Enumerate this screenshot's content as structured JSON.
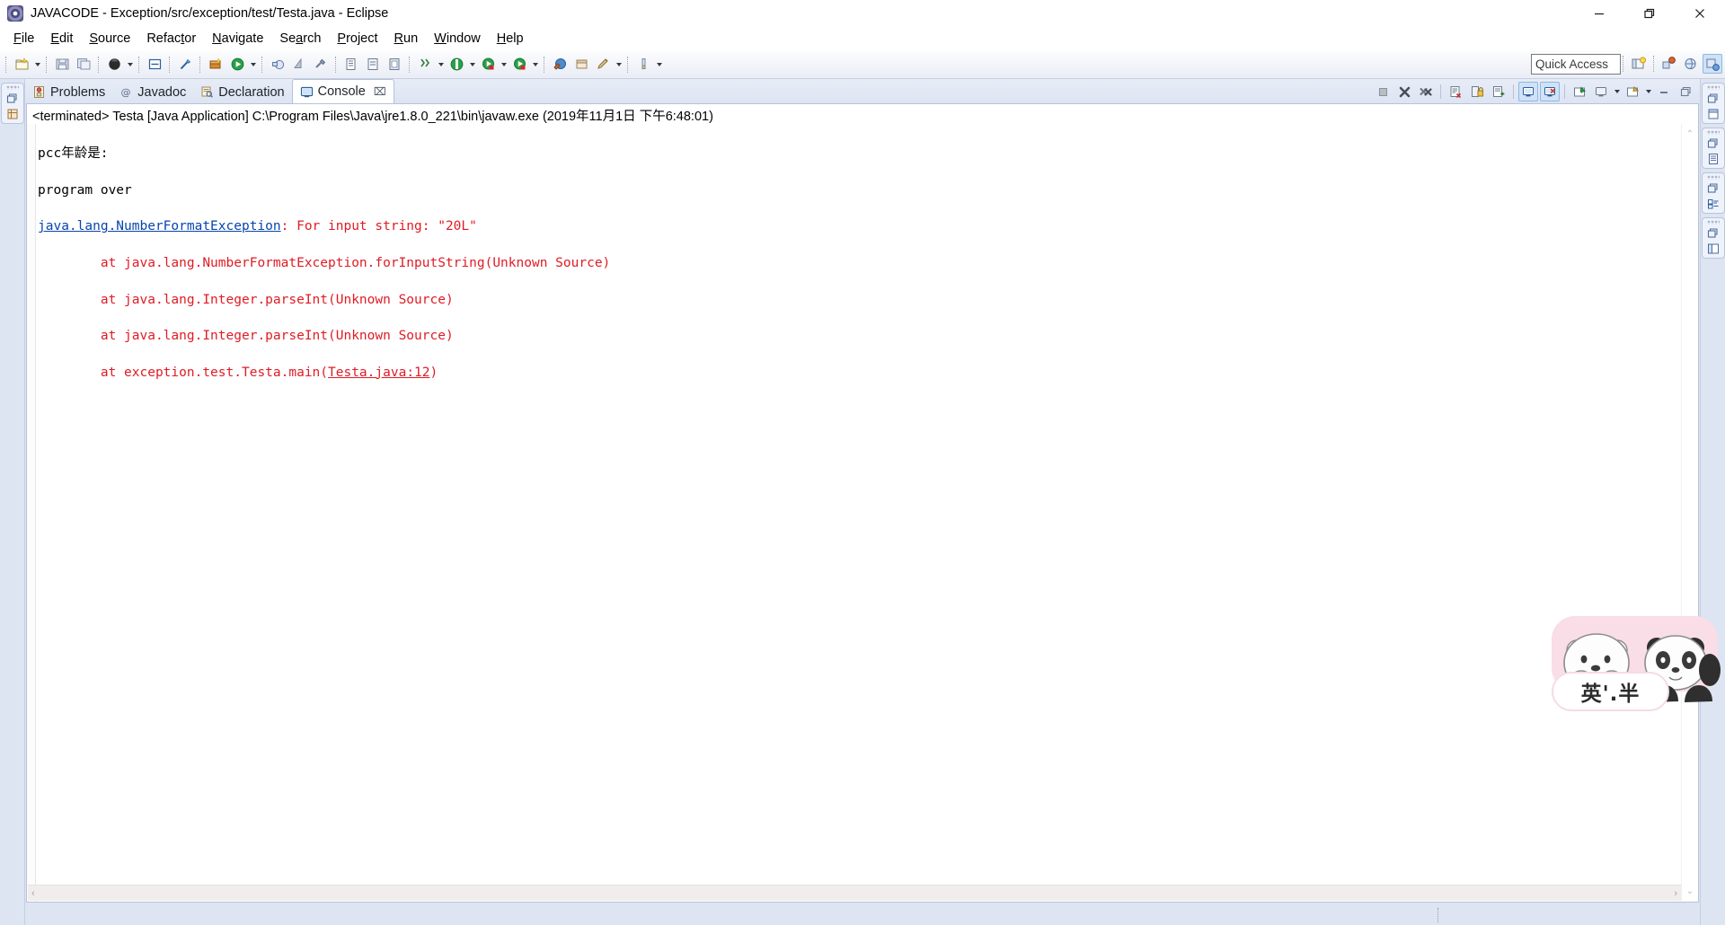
{
  "window": {
    "title": "JAVACODE - Exception/src/exception/test/Testa.java - Eclipse",
    "icon": "eclipse-icon",
    "minimize_label": "Minimize",
    "maximize_label": "Restore",
    "close_label": "Close"
  },
  "menubar": {
    "items": [
      {
        "label": "File",
        "mnemonic": "F"
      },
      {
        "label": "Edit",
        "mnemonic": "E"
      },
      {
        "label": "Source",
        "mnemonic": "S"
      },
      {
        "label": "Refactor",
        "mnemonic": "t"
      },
      {
        "label": "Navigate",
        "mnemonic": "N"
      },
      {
        "label": "Search",
        "mnemonic": "a"
      },
      {
        "label": "Project",
        "mnemonic": "P"
      },
      {
        "label": "Run",
        "mnemonic": "R"
      },
      {
        "label": "Window",
        "mnemonic": "W"
      },
      {
        "label": "Help",
        "mnemonic": "H"
      }
    ]
  },
  "toolbar": {
    "buttons": [
      "new-wizard-icon",
      "new-wizard-dropdown",
      "save-icon",
      "save-all-icon",
      "debug-icon",
      "debug-dropdown",
      "new-java-class-icon",
      "link-icon",
      "open-type-icon",
      "run-icon",
      "run-dropdown",
      "run-last-tool-icon",
      "skip-breakpoints-icon",
      "build-all-icon",
      "open-task-icon",
      "previous-annotation-icon",
      "next-annotation-icon",
      "search-icon",
      "search-dropdown",
      "debug-perspective-icon",
      "debug-dropdown-2",
      "run-as-icon",
      "run-as-dropdown",
      "external-tools-icon",
      "external-tools-dropdown",
      "open-perspective-icon",
      "restore-icon",
      "pin-editor-icon",
      "pin-dropdown",
      "toggle-mark-occurrences-icon",
      "toggle-dropdown"
    ]
  },
  "quick_access": {
    "placeholder": "Quick Access",
    "value": "Quick Access"
  },
  "perspective_bar": {
    "open_perspective_label": "Open Perspective",
    "perspectives": [
      {
        "name": "perspective-java-ee-icon",
        "active": false
      },
      {
        "name": "perspective-web-icon",
        "active": false
      },
      {
        "name": "perspective-java-icon",
        "active": true
      }
    ]
  },
  "left_fastview": {
    "items": [
      {
        "name": "package-explorer-icon",
        "label": "Package Explorer"
      }
    ]
  },
  "right_fastview": {
    "items": [
      {
        "name": "outline-icon",
        "label": "Outline"
      },
      {
        "name": "task-list-icon",
        "label": "Task List"
      },
      {
        "name": "properties-icon",
        "label": "Properties"
      },
      {
        "name": "templates-icon",
        "label": "Templates"
      }
    ]
  },
  "view_tabs": {
    "tabs": [
      {
        "label": "Problems",
        "icon": "problems-icon",
        "active": false,
        "closable": false
      },
      {
        "label": "Javadoc",
        "icon": "javadoc-icon",
        "active": false,
        "closable": false
      },
      {
        "label": "Declaration",
        "icon": "declaration-icon",
        "active": false,
        "closable": false
      },
      {
        "label": "Console",
        "icon": "console-icon",
        "active": true,
        "closable": true
      }
    ],
    "close_glyph": "⌧"
  },
  "view_toolbar": {
    "buttons": [
      {
        "name": "terminate-icon",
        "label": "Terminate",
        "toggled": false,
        "enabled": false
      },
      {
        "name": "remove-launch-icon",
        "label": "Remove Launch",
        "toggled": false,
        "enabled": true
      },
      {
        "name": "remove-all-launches-icon",
        "label": "Remove All Terminated Launches",
        "toggled": false,
        "enabled": true
      },
      {
        "name": "clear-console-icon",
        "label": "Clear Console",
        "toggled": false,
        "enabled": true
      },
      {
        "name": "scroll-lock-icon",
        "label": "Scroll Lock",
        "toggled": false,
        "enabled": true
      },
      {
        "name": "word-wrap-icon",
        "label": "Word Wrap",
        "toggled": false,
        "enabled": true
      },
      {
        "name": "show-console-on-output-icon",
        "label": "Show Console When Standard Out Changes",
        "toggled": true,
        "enabled": true
      },
      {
        "name": "show-console-on-error-icon",
        "label": "Show Console When Standard Error Changes",
        "toggled": true,
        "enabled": true
      },
      {
        "name": "pin-console-icon",
        "label": "Pin Console",
        "toggled": false,
        "enabled": true
      },
      {
        "name": "display-selected-console-icon",
        "label": "Display Selected Console",
        "toggled": false,
        "enabled": true
      },
      {
        "name": "display-console-dropdown",
        "label": "Display Selected Console Menu",
        "toggled": false,
        "enabled": true
      },
      {
        "name": "open-console-icon",
        "label": "Open Console",
        "toggled": false,
        "enabled": true
      },
      {
        "name": "open-console-dropdown",
        "label": "Open Console Menu",
        "toggled": false,
        "enabled": true
      },
      {
        "name": "minimize-view-icon",
        "label": "Minimize",
        "toggled": false,
        "enabled": true
      },
      {
        "name": "maximize-view-icon",
        "label": "Maximize",
        "toggled": false,
        "enabled": true
      }
    ]
  },
  "console": {
    "header": "<terminated> Testa [Java Application] C:\\Program Files\\Java\\jre1.8.0_221\\bin\\javaw.exe (2019年11月1日 下午6:48:01)",
    "lines": [
      {
        "type": "out",
        "segments": [
          {
            "text": "pcc年龄是:",
            "style": "plain"
          }
        ]
      },
      {
        "type": "out",
        "segments": [
          {
            "text": "program over",
            "style": "plain"
          }
        ]
      },
      {
        "type": "err",
        "segments": [
          {
            "text": "java.lang.NumberFormatException",
            "style": "link"
          },
          {
            "text": ": For input string: \"20L\"",
            "style": "error"
          }
        ]
      },
      {
        "type": "err",
        "segments": [
          {
            "text": "\tat java.lang.NumberFormatException.forInputString(Unknown Source)",
            "style": "error"
          }
        ]
      },
      {
        "type": "err",
        "segments": [
          {
            "text": "\tat java.lang.Integer.parseInt(Unknown Source)",
            "style": "error"
          }
        ]
      },
      {
        "type": "err",
        "segments": [
          {
            "text": "\tat java.lang.Integer.parseInt(Unknown Source)",
            "style": "error"
          }
        ]
      },
      {
        "type": "err",
        "segments": [
          {
            "text": "\tat exception.test.Testa.main(",
            "style": "error"
          },
          {
            "text": "Testa.java:12",
            "style": "error-link"
          },
          {
            "text": ")",
            "style": "error"
          }
        ]
      }
    ],
    "scrollbar": {
      "up_glyph": "⌃",
      "down_glyph": "⌄",
      "left_glyph": "‹",
      "right_glyph": "›"
    }
  },
  "sticker": {
    "caption": "英'.半",
    "alt": "we-bare-bears-sticker"
  },
  "colors": {
    "error_red": "#e01b24",
    "link_blue": "#0645ad",
    "chrome_blue": "#dde4f2",
    "tab_active_bg": "#ffffff",
    "toggled_blue": "#cfe2f7",
    "sticker_pink": "#f9dde7"
  }
}
